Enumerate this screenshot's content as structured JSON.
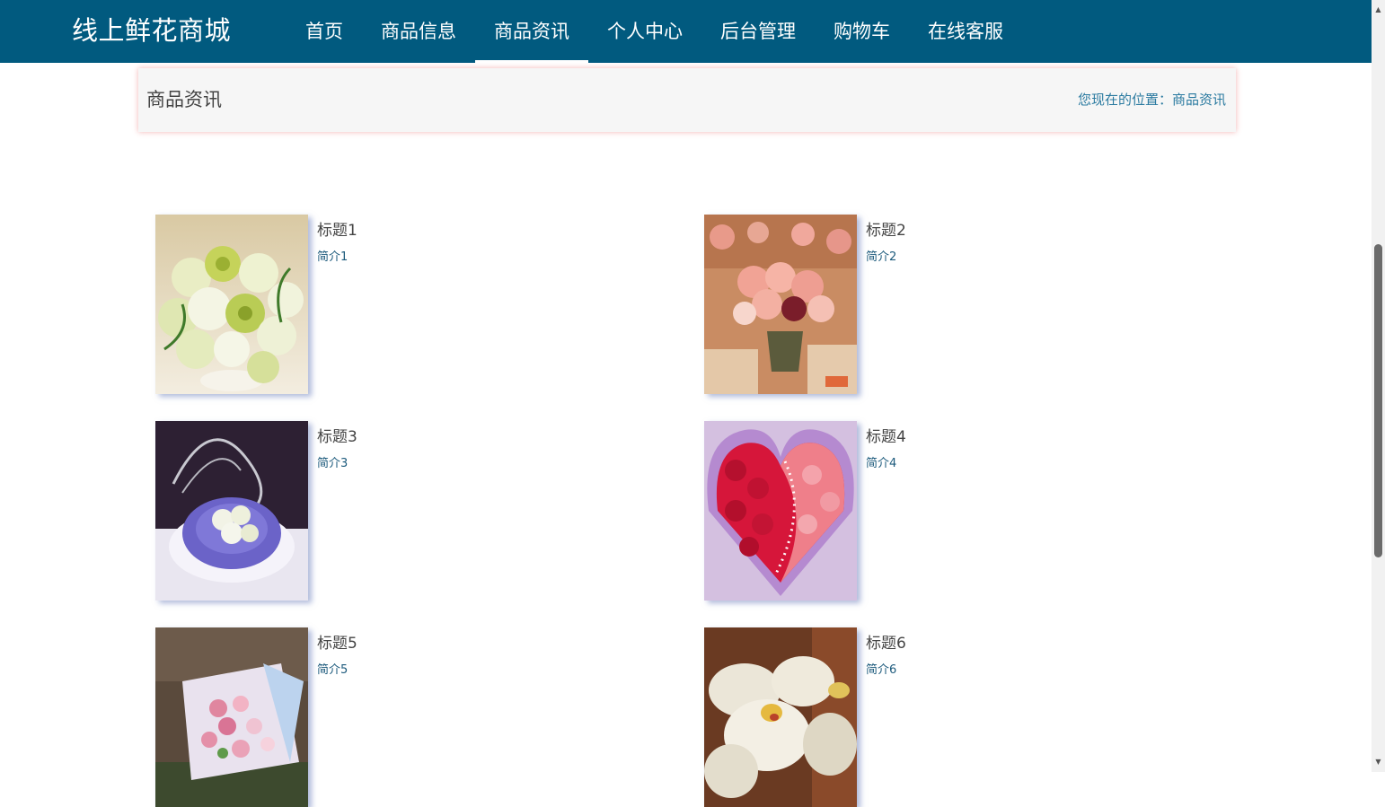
{
  "header": {
    "brand": "线上鲜花商城",
    "nav": [
      {
        "label": "首页",
        "active": false
      },
      {
        "label": "商品信息",
        "active": false
      },
      {
        "label": "商品资讯",
        "active": true
      },
      {
        "label": "个人中心",
        "active": false
      },
      {
        "label": "后台管理",
        "active": false
      },
      {
        "label": "购物车",
        "active": false
      },
      {
        "label": "在线客服",
        "active": false
      }
    ]
  },
  "breadcrumb": {
    "title": "商品资讯",
    "location": "您现在的位置：商品资讯"
  },
  "news": [
    {
      "title": "标题1",
      "summary": "简介1",
      "image": "white-green-bouquet"
    },
    {
      "title": "标题2",
      "summary": "简介2",
      "image": "pink-roses-vase"
    },
    {
      "title": "标题3",
      "summary": "简介3",
      "image": "purple-heart-arrangement"
    },
    {
      "title": "标题4",
      "summary": "简介4",
      "image": "red-roses-heart-box"
    },
    {
      "title": "标题5",
      "summary": "简介5",
      "image": "pink-wrapped-bouquet"
    },
    {
      "title": "标题6",
      "summary": "简介6",
      "image": "white-orchid"
    }
  ],
  "colors": {
    "nav_background": "#015a7f",
    "breadcrumb_background": "#f6f6f6",
    "location_text": "#2a7aa0",
    "summary_text": "#1c5a7c"
  },
  "scrollbar": {
    "up_arrow_icon": "triangle-up-icon",
    "down_arrow_icon": "triangle-down-icon"
  }
}
